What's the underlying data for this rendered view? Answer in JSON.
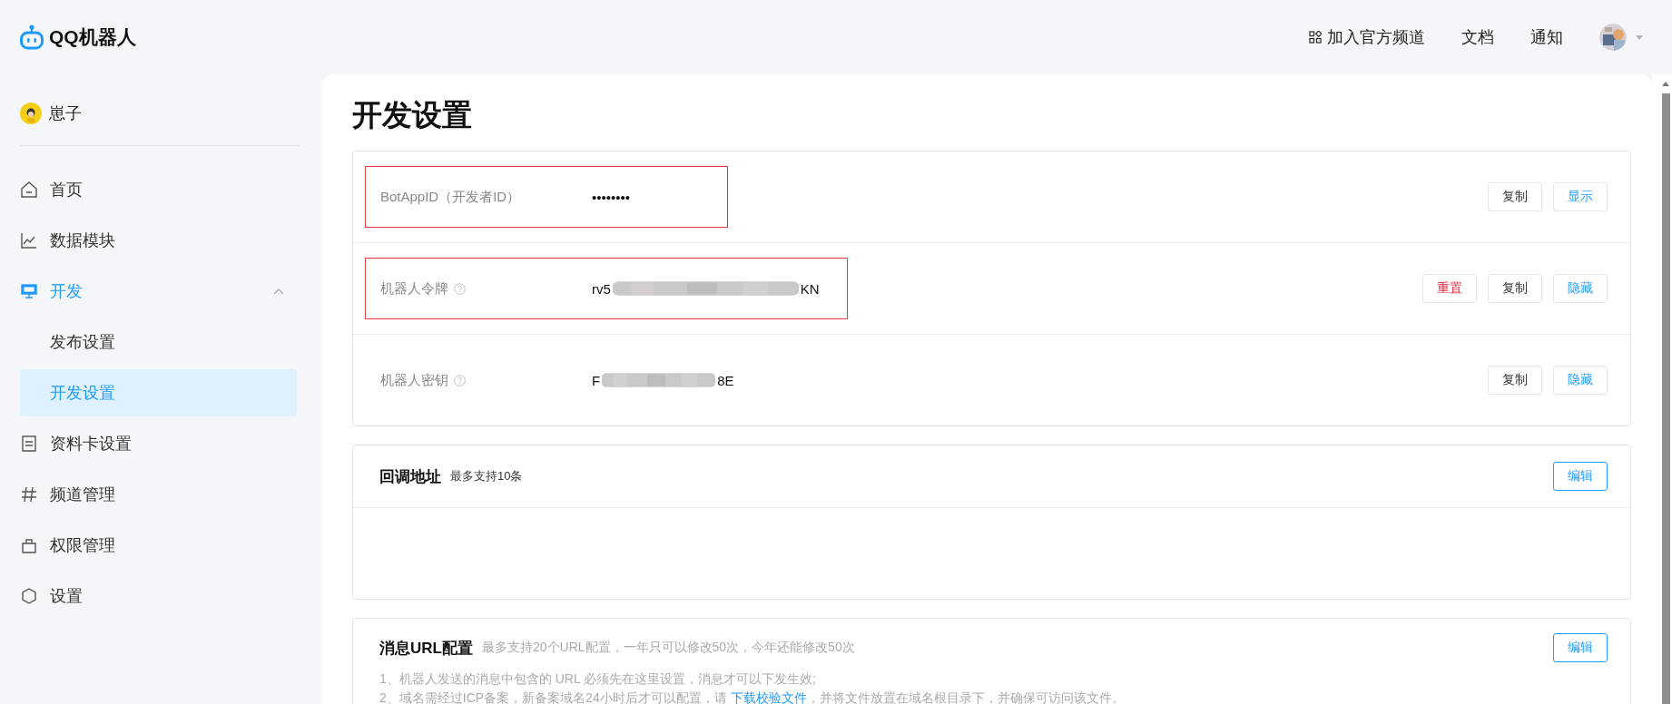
{
  "header": {
    "logo_text": "QQ机器人",
    "nav": [
      {
        "label": "加入官方频道",
        "kind": "icon-link"
      },
      {
        "label": "文档",
        "kind": "link"
      },
      {
        "label": "通知",
        "kind": "link"
      }
    ]
  },
  "sidebar": {
    "user": {
      "name": "崽子"
    },
    "items": [
      {
        "label": "首页",
        "selected": false
      },
      {
        "label": "数据模块",
        "selected": false
      },
      {
        "label": "开发",
        "selected": true,
        "expanded": true,
        "children": [
          {
            "label": "发布设置",
            "selected": false
          },
          {
            "label": "开发设置",
            "selected": true
          }
        ]
      },
      {
        "label": "资料卡设置",
        "selected": false
      },
      {
        "label": "频道管理",
        "selected": false
      },
      {
        "label": "权限管理",
        "selected": false
      },
      {
        "label": "设置",
        "selected": false
      }
    ]
  },
  "page_title": "开发设置",
  "credentials": [
    {
      "label": "BotAppID（开发者ID）",
      "help": false,
      "highlighted": true,
      "value_start": "••••••••",
      "masked": false,
      "buttons": [
        {
          "label": "复制",
          "kind": "default"
        },
        {
          "label": "显示",
          "kind": "primary"
        }
      ]
    },
    {
      "label": "机器人令牌",
      "help": true,
      "highlighted": true,
      "value_start": "rv5",
      "masked": true,
      "value_end": "KN",
      "buttons": [
        {
          "label": "重置",
          "kind": "danger"
        },
        {
          "label": "复制",
          "kind": "default"
        },
        {
          "label": "隐藏",
          "kind": "primary"
        }
      ]
    },
    {
      "label": "机器人密钥",
      "help": true,
      "highlighted": false,
      "value_start": "F",
      "masked": true,
      "value_end": "8E",
      "buttons": [
        {
          "label": "复制",
          "kind": "default"
        },
        {
          "label": "隐藏",
          "kind": "primary"
        }
      ]
    }
  ],
  "callback": {
    "title": "回调地址",
    "note": "最多支持10条",
    "button": "编辑"
  },
  "message_url": {
    "title": "消息URL配置",
    "note": "最多支持20个URL配置，一年只可以修改50次，今年还能修改50次",
    "button": "编辑",
    "lines": [
      {
        "text": "1、机器人发送的消息中包含的 URL 必须先在这里设置，消息才可以下发生效;"
      },
      {
        "text": "2、域名需经过ICP备案，新备案域名24小时后才可以配置，请 ",
        "link": "下载校验文件",
        "after": "，并将文件放置在域名根目录下，并确保可访问该文件。"
      }
    ]
  }
}
